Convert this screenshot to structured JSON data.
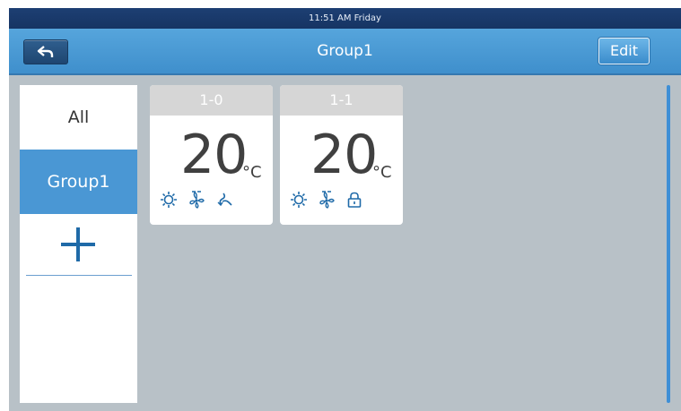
{
  "status_bar": {
    "time": "11:51 AM",
    "day": "Friday",
    "text": "11:51 AM Friday"
  },
  "header": {
    "title": "Group1",
    "back_icon": "back-arrow-icon",
    "edit_label": "Edit"
  },
  "sidebar": {
    "items": [
      {
        "label": "All",
        "active": false
      },
      {
        "label": "Group1",
        "active": true
      }
    ],
    "add_icon": "plus-icon"
  },
  "units": [
    {
      "name": "1-0",
      "temperature": "20",
      "unit": "°C",
      "icons": [
        "sun-icon",
        "fan-icon",
        "swing-icon"
      ]
    },
    {
      "name": "1-1",
      "temperature": "20",
      "unit": "°C",
      "icons": [
        "sun-icon",
        "fan-icon",
        "lock-icon"
      ]
    }
  ],
  "colors": {
    "header": "#4a9bd6",
    "status_bar": "#1b3b6e",
    "accent": "#4a97d4",
    "background": "#b8c1c7"
  }
}
